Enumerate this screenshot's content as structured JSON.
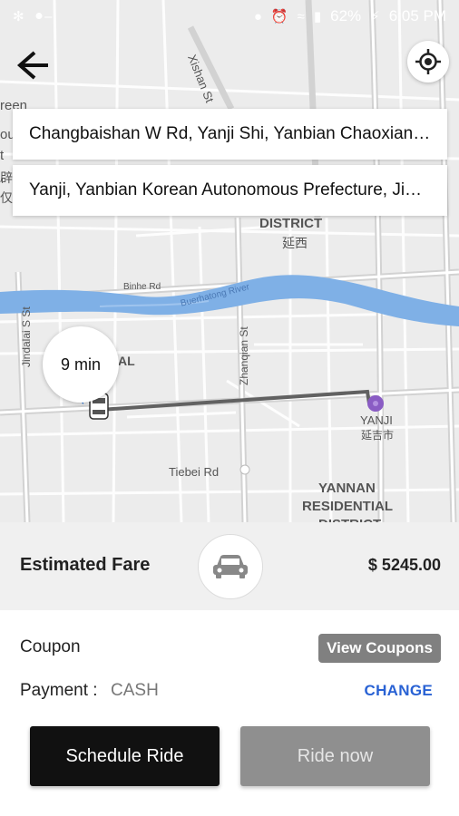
{
  "status_bar": {
    "battery": "62%",
    "time": "6:05 PM"
  },
  "search": {
    "pickup": "Changbaishan W Rd, Yanji Shi, Yanbian Chaoxian…",
    "dropoff": "Yanji, Yanbian Korean Autonomous Prefecture, Ji…"
  },
  "map": {
    "eta": "9 min",
    "labels": {
      "xishan_st": "Xishan St",
      "district": "DISTRICT",
      "district_cn": "延西",
      "binhe_rd": "Binhe Rd",
      "buerhatong_river": "Buerhatong River",
      "jindalai_st": "Jindalai S St",
      "zhanqian_st": "Zhanqian St",
      "al": "AL",
      "yanji": "YANJI",
      "yanji_cn": "延吉市",
      "tiebei_rd": "Tiebei Rd",
      "yannan": "YANNAN",
      "residential": "RESIDENTIAL",
      "district2": "DISTRICT",
      "left_fragment_1": "reen",
      "left_fragment_2": "ou",
      "left_fragment_3": "t",
      "left_fragment_4": "辟",
      "left_fragment_5": "仅"
    },
    "colors": {
      "river": "#7fb0e6",
      "route": "#616161",
      "pickup_dot": "#2f7de1",
      "dropoff_pin": "#8a5cc4"
    }
  },
  "fare": {
    "label": "Estimated Fare",
    "value": "$ 5245.00"
  },
  "coupon": {
    "label": "Coupon",
    "button": "View Coupons"
  },
  "payment": {
    "label": "Payment :",
    "value": "CASH",
    "change": "CHANGE"
  },
  "actions": {
    "schedule": "Schedule Ride",
    "ride_now": "Ride now"
  }
}
